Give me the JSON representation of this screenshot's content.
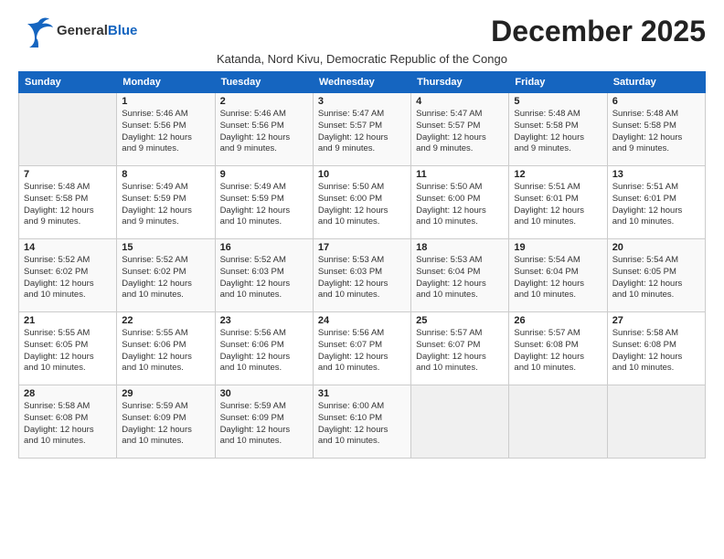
{
  "logo": {
    "general": "General",
    "blue": "Blue"
  },
  "title": "December 2025",
  "subtitle": "Katanda, Nord Kivu, Democratic Republic of the Congo",
  "days_of_week": [
    "Sunday",
    "Monday",
    "Tuesday",
    "Wednesday",
    "Thursday",
    "Friday",
    "Saturday"
  ],
  "weeks": [
    [
      {
        "day": "",
        "info": ""
      },
      {
        "day": "1",
        "info": "Sunrise: 5:46 AM\nSunset: 5:56 PM\nDaylight: 12 hours\nand 9 minutes."
      },
      {
        "day": "2",
        "info": "Sunrise: 5:46 AM\nSunset: 5:56 PM\nDaylight: 12 hours\nand 9 minutes."
      },
      {
        "day": "3",
        "info": "Sunrise: 5:47 AM\nSunset: 5:57 PM\nDaylight: 12 hours\nand 9 minutes."
      },
      {
        "day": "4",
        "info": "Sunrise: 5:47 AM\nSunset: 5:57 PM\nDaylight: 12 hours\nand 9 minutes."
      },
      {
        "day": "5",
        "info": "Sunrise: 5:48 AM\nSunset: 5:58 PM\nDaylight: 12 hours\nand 9 minutes."
      },
      {
        "day": "6",
        "info": "Sunrise: 5:48 AM\nSunset: 5:58 PM\nDaylight: 12 hours\nand 9 minutes."
      }
    ],
    [
      {
        "day": "7",
        "info": "Sunrise: 5:48 AM\nSunset: 5:58 PM\nDaylight: 12 hours\nand 9 minutes."
      },
      {
        "day": "8",
        "info": "Sunrise: 5:49 AM\nSunset: 5:59 PM\nDaylight: 12 hours\nand 9 minutes."
      },
      {
        "day": "9",
        "info": "Sunrise: 5:49 AM\nSunset: 5:59 PM\nDaylight: 12 hours\nand 10 minutes."
      },
      {
        "day": "10",
        "info": "Sunrise: 5:50 AM\nSunset: 6:00 PM\nDaylight: 12 hours\nand 10 minutes."
      },
      {
        "day": "11",
        "info": "Sunrise: 5:50 AM\nSunset: 6:00 PM\nDaylight: 12 hours\nand 10 minutes."
      },
      {
        "day": "12",
        "info": "Sunrise: 5:51 AM\nSunset: 6:01 PM\nDaylight: 12 hours\nand 10 minutes."
      },
      {
        "day": "13",
        "info": "Sunrise: 5:51 AM\nSunset: 6:01 PM\nDaylight: 12 hours\nand 10 minutes."
      }
    ],
    [
      {
        "day": "14",
        "info": "Sunrise: 5:52 AM\nSunset: 6:02 PM\nDaylight: 12 hours\nand 10 minutes."
      },
      {
        "day": "15",
        "info": "Sunrise: 5:52 AM\nSunset: 6:02 PM\nDaylight: 12 hours\nand 10 minutes."
      },
      {
        "day": "16",
        "info": "Sunrise: 5:52 AM\nSunset: 6:03 PM\nDaylight: 12 hours\nand 10 minutes."
      },
      {
        "day": "17",
        "info": "Sunrise: 5:53 AM\nSunset: 6:03 PM\nDaylight: 12 hours\nand 10 minutes."
      },
      {
        "day": "18",
        "info": "Sunrise: 5:53 AM\nSunset: 6:04 PM\nDaylight: 12 hours\nand 10 minutes."
      },
      {
        "day": "19",
        "info": "Sunrise: 5:54 AM\nSunset: 6:04 PM\nDaylight: 12 hours\nand 10 minutes."
      },
      {
        "day": "20",
        "info": "Sunrise: 5:54 AM\nSunset: 6:05 PM\nDaylight: 12 hours\nand 10 minutes."
      }
    ],
    [
      {
        "day": "21",
        "info": "Sunrise: 5:55 AM\nSunset: 6:05 PM\nDaylight: 12 hours\nand 10 minutes."
      },
      {
        "day": "22",
        "info": "Sunrise: 5:55 AM\nSunset: 6:06 PM\nDaylight: 12 hours\nand 10 minutes."
      },
      {
        "day": "23",
        "info": "Sunrise: 5:56 AM\nSunset: 6:06 PM\nDaylight: 12 hours\nand 10 minutes."
      },
      {
        "day": "24",
        "info": "Sunrise: 5:56 AM\nSunset: 6:07 PM\nDaylight: 12 hours\nand 10 minutes."
      },
      {
        "day": "25",
        "info": "Sunrise: 5:57 AM\nSunset: 6:07 PM\nDaylight: 12 hours\nand 10 minutes."
      },
      {
        "day": "26",
        "info": "Sunrise: 5:57 AM\nSunset: 6:08 PM\nDaylight: 12 hours\nand 10 minutes."
      },
      {
        "day": "27",
        "info": "Sunrise: 5:58 AM\nSunset: 6:08 PM\nDaylight: 12 hours\nand 10 minutes."
      }
    ],
    [
      {
        "day": "28",
        "info": "Sunrise: 5:58 AM\nSunset: 6:08 PM\nDaylight: 12 hours\nand 10 minutes."
      },
      {
        "day": "29",
        "info": "Sunrise: 5:59 AM\nSunset: 6:09 PM\nDaylight: 12 hours\nand 10 minutes."
      },
      {
        "day": "30",
        "info": "Sunrise: 5:59 AM\nSunset: 6:09 PM\nDaylight: 12 hours\nand 10 minutes."
      },
      {
        "day": "31",
        "info": "Sunrise: 6:00 AM\nSunset: 6:10 PM\nDaylight: 12 hours\nand 10 minutes."
      },
      {
        "day": "",
        "info": ""
      },
      {
        "day": "",
        "info": ""
      },
      {
        "day": "",
        "info": ""
      }
    ]
  ]
}
